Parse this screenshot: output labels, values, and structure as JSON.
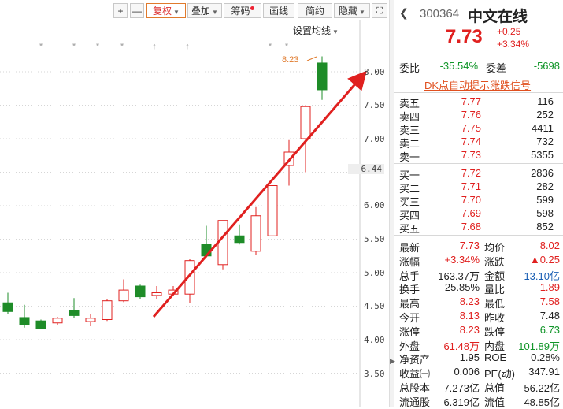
{
  "toolbar": {
    "plus": "+",
    "minus": "—",
    "restore": "复权",
    "overlay": "叠加",
    "chips": "筹码",
    "draw": "画线",
    "summary": "简约",
    "hide": "隐藏"
  },
  "chart": {
    "ma_setting": "设置均线",
    "y_ticks": [
      "8.00",
      "7.50",
      "7.00",
      "6.00",
      "5.50",
      "5.00",
      "4.50",
      "4.00",
      "3.50"
    ],
    "current_price_label": "6.44",
    "high_marker": "8.23",
    "candles": [
      {
        "o": 4.55,
        "c": 4.42,
        "h": 4.7,
        "l": 4.38
      },
      {
        "o": 4.33,
        "c": 4.22,
        "h": 4.52,
        "l": 4.18
      },
      {
        "o": 4.28,
        "c": 4.16,
        "h": 4.3,
        "l": 4.16
      },
      {
        "o": 4.25,
        "c": 4.32,
        "h": 4.34,
        "l": 4.22
      },
      {
        "o": 4.43,
        "c": 4.36,
        "h": 4.62,
        "l": 4.33
      },
      {
        "o": 4.27,
        "c": 4.32,
        "h": 4.38,
        "l": 4.2
      },
      {
        "o": 4.3,
        "c": 4.58,
        "h": 4.6,
        "l": 4.28
      },
      {
        "o": 4.58,
        "c": 4.74,
        "h": 4.9,
        "l": 4.56
      },
      {
        "o": 4.8,
        "c": 4.64,
        "h": 4.82,
        "l": 4.61
      },
      {
        "o": 4.66,
        "c": 4.7,
        "h": 4.8,
        "l": 4.6
      },
      {
        "o": 4.68,
        "c": 4.74,
        "h": 4.8,
        "l": 4.66
      },
      {
        "o": 4.68,
        "c": 5.18,
        "h": 5.2,
        "l": 4.55
      },
      {
        "o": 5.42,
        "c": 5.25,
        "h": 5.7,
        "l": 5.22
      },
      {
        "o": 5.12,
        "c": 5.78,
        "h": 5.78,
        "l": 5.05
      },
      {
        "o": 5.55,
        "c": 5.45,
        "h": 5.72,
        "l": 5.42
      },
      {
        "o": 5.32,
        "c": 5.85,
        "h": 5.98,
        "l": 5.26
      },
      {
        "o": 5.55,
        "c": 6.3,
        "h": 6.3,
        "l": 5.55
      },
      {
        "o": 6.6,
        "c": 6.8,
        "h": 6.98,
        "l": 6.3
      },
      {
        "o": 7.0,
        "c": 7.48,
        "h": 7.5,
        "l": 6.5
      },
      {
        "o": 8.13,
        "c": 7.73,
        "h": 8.23,
        "l": 7.58
      }
    ],
    "colors": {
      "up": "#e0201f",
      "down": "#1e8c28",
      "arrow": "#e0201f"
    }
  },
  "quote": {
    "code": "300364",
    "name": "中文在线",
    "price": "7.73",
    "change": "+0.25",
    "change_pct": "+3.34%",
    "webi_label": "委比",
    "webi_value": "-35.54%",
    "weicha_label": "委差",
    "weicha_value": "-5698",
    "dk_signal": "DK点自动提示涨跌信号",
    "asks": [
      {
        "label": "卖五",
        "price": "7.77",
        "vol": "116"
      },
      {
        "label": "卖四",
        "price": "7.76",
        "vol": "252"
      },
      {
        "label": "卖三",
        "price": "7.75",
        "vol": "4411"
      },
      {
        "label": "卖二",
        "price": "7.74",
        "vol": "732"
      },
      {
        "label": "卖一",
        "price": "7.73",
        "vol": "5355"
      }
    ],
    "bids": [
      {
        "label": "买一",
        "price": "7.72",
        "vol": "2836"
      },
      {
        "label": "买二",
        "price": "7.71",
        "vol": "282"
      },
      {
        "label": "买三",
        "price": "7.70",
        "vol": "599"
      },
      {
        "label": "买四",
        "price": "7.69",
        "vol": "598"
      },
      {
        "label": "买五",
        "price": "7.68",
        "vol": "852"
      }
    ],
    "stats": [
      {
        "l1": "最新",
        "v1": "7.73",
        "c1": "red",
        "l2": "均价",
        "v2": "8.02",
        "c2": "red"
      },
      {
        "l1": "涨幅",
        "v1": "+3.34%",
        "c1": "red",
        "l2": "涨跌",
        "v2": "▲0.25",
        "c2": "red"
      },
      {
        "l1": "总手",
        "v1": "163.37万",
        "c1": "",
        "l2": "金额",
        "v2": "13.10亿",
        "c2": "blue"
      },
      {
        "l1": "换手",
        "v1": "25.85%",
        "c1": "",
        "l2": "量比",
        "v2": "1.89",
        "c2": "red"
      },
      {
        "l1": "最高",
        "v1": "8.23",
        "c1": "red",
        "l2": "最低",
        "v2": "7.58",
        "c2": "red"
      },
      {
        "l1": "今开",
        "v1": "8.13",
        "c1": "red",
        "l2": "昨收",
        "v2": "7.48",
        "c2": ""
      },
      {
        "l1": "涨停",
        "v1": "8.23",
        "c1": "red",
        "l2": "跌停",
        "v2": "6.73",
        "c2": "green"
      },
      {
        "l1": "外盘",
        "v1": "61.48万",
        "c1": "red",
        "l2": "内盘",
        "v2": "101.89万",
        "c2": "green"
      },
      {
        "l1": "净资产",
        "v1": "1.95",
        "c1": "",
        "l2": "ROE",
        "v2": "0.28%",
        "c2": ""
      },
      {
        "l1": "收益㈠",
        "v1": "0.006",
        "c1": "",
        "l2": "PE(动)",
        "v2": "347.91",
        "c2": ""
      },
      {
        "l1": "总股本",
        "v1": "7.273亿",
        "c1": "",
        "l2": "总值",
        "v2": "56.22亿",
        "c2": ""
      },
      {
        "l1": "流通股",
        "v1": "6.319亿",
        "c1": "",
        "l2": "流值",
        "v2": "48.85亿",
        "c2": ""
      }
    ]
  }
}
